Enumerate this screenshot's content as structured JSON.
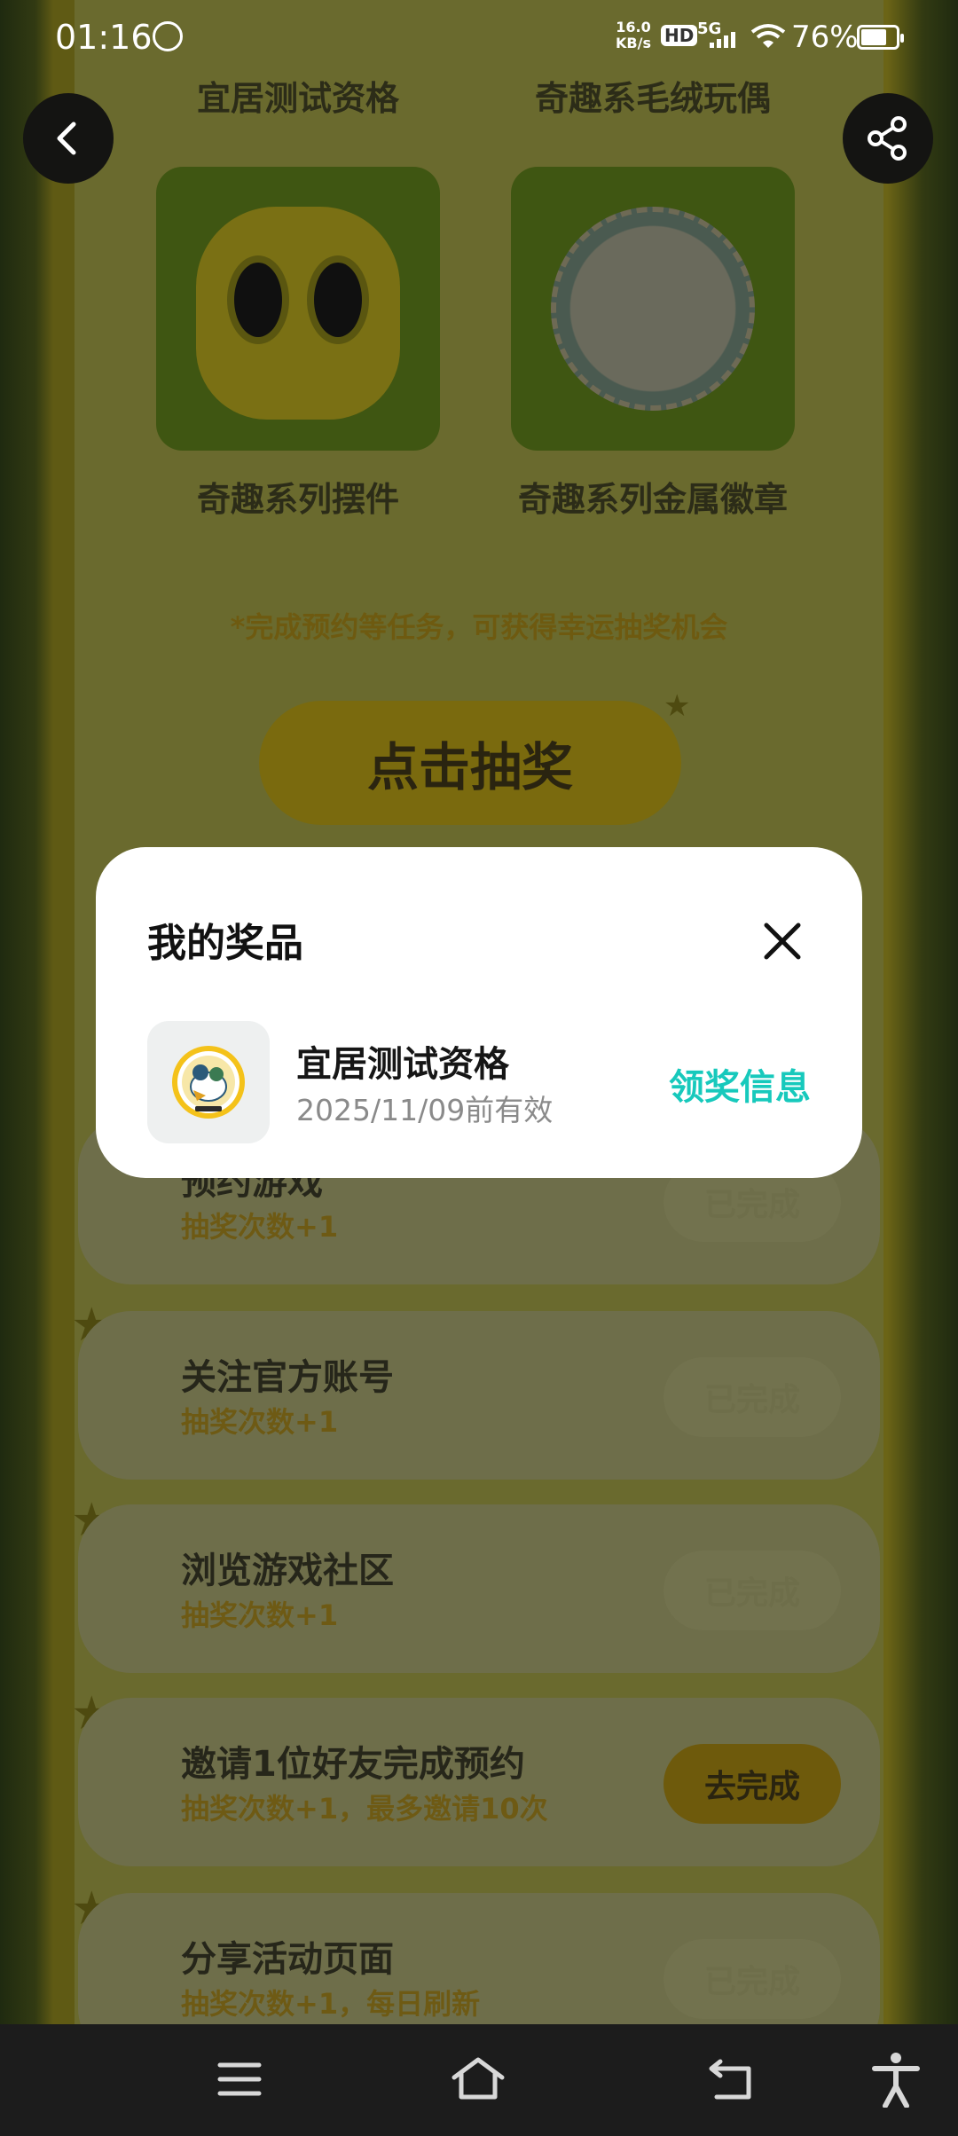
{
  "status_bar": {
    "time": "01:16",
    "net_speed_value": "16.0",
    "net_speed_unit": "KB/s",
    "hd_label": "HD",
    "network_label": "5G",
    "battery_percent": "76%",
    "battery_level": 0.76
  },
  "prizes": [
    {
      "name": "宜居测试资格"
    },
    {
      "name": "奇趣系毛绒玩偶"
    },
    {
      "name": "奇趣系列摆件"
    },
    {
      "name": "奇趣系列金属徽章"
    }
  ],
  "lottery": {
    "hint": "*完成预约等任务，可获得幸运抽奖机会",
    "draw_button": "点击抽奖"
  },
  "tasks": [
    {
      "title": "预约游戏",
      "reward": "抽奖次数+1",
      "button": "已完成",
      "active": false
    },
    {
      "title": "关注官方账号",
      "reward": "抽奖次数+1",
      "button": "已完成",
      "active": false
    },
    {
      "title": "浏览游戏社区",
      "reward": "抽奖次数+1",
      "button": "已完成",
      "active": false
    },
    {
      "title": "邀请1位好友完成预约",
      "reward": "抽奖次数+1，最多邀请10次",
      "button": "去完成",
      "active": true
    },
    {
      "title": "分享活动页面",
      "reward": "抽奖次数+1，每日刷新",
      "button": "已完成",
      "active": false
    }
  ],
  "modal": {
    "title": "我的奖品",
    "item": {
      "name": "宜居测试资格",
      "validity": "2025/11/09前有效",
      "action": "领奖信息"
    }
  },
  "colors": {
    "accent": "#17c9bc",
    "modal_bg": "#ffffff"
  },
  "icons": [
    "back-icon",
    "share-icon",
    "close-icon",
    "menu-icon",
    "home-icon",
    "return-icon",
    "accessibility-icon"
  ]
}
